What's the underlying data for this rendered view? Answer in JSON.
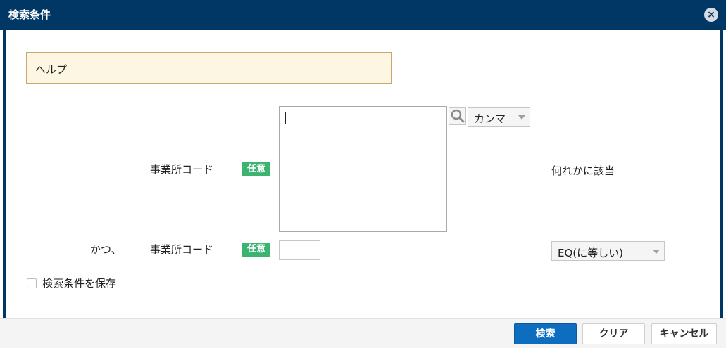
{
  "dialog": {
    "title": "検索条件",
    "close_icon": "close-icon",
    "help_text": "ヘルプ"
  },
  "conditions": [
    {
      "connector": "",
      "label": "事業所コード",
      "badge": "任意",
      "input_type": "textarea",
      "value": "",
      "search_icon": "search-icon",
      "separator": "カンマ",
      "match_text": "何れかに該当"
    },
    {
      "connector": "かつ、",
      "label": "事業所コード",
      "badge": "任意",
      "input_type": "text",
      "value": "",
      "operator": "EQ(に等しい)"
    }
  ],
  "options": {
    "save_conditions_label": "検索条件を保存",
    "save_conditions_checked": false
  },
  "footer": {
    "search_label": "検索",
    "clear_label": "クリア",
    "cancel_label": "キャンセル"
  },
  "colors": {
    "titlebar": "#003764",
    "badge": "#3cb371",
    "primary_button": "#0d6ebf",
    "help_bg": "#fdf6e3"
  }
}
